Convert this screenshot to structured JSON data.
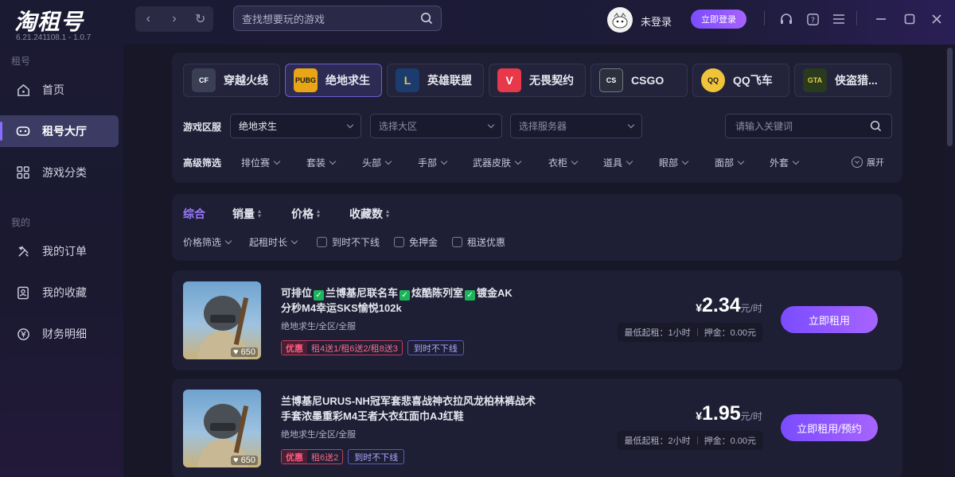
{
  "app": {
    "logo": "淘租号",
    "version": "6.21.241108.1 - 1.0.7"
  },
  "sidebar": {
    "section1": "租号",
    "section2": "我的",
    "items": [
      {
        "label": "首页",
        "icon": "home-icon"
      },
      {
        "label": "租号大厅",
        "icon": "gamepad-icon",
        "active": true
      },
      {
        "label": "游戏分类",
        "icon": "grid-icon"
      },
      {
        "label": "我的订单",
        "icon": "tools-icon"
      },
      {
        "label": "我的收藏",
        "icon": "bookmark-icon"
      },
      {
        "label": "财务明细",
        "icon": "money-icon"
      }
    ]
  },
  "topbar": {
    "search_placeholder": "查找想要玩的游戏",
    "user_name": "未登录",
    "login_label": "立即登录"
  },
  "games": [
    {
      "name": "穿越火线",
      "icon_text": "CF"
    },
    {
      "name": "绝地求生",
      "icon_text": "PUBG",
      "selected": true
    },
    {
      "name": "英雄联盟",
      "icon_text": "L"
    },
    {
      "name": "无畏契约",
      "icon_text": "V"
    },
    {
      "name": "CSGO",
      "icon_text": "CS"
    },
    {
      "name": "QQ飞车",
      "icon_text": "QQ"
    },
    {
      "name": "侠盗猎...",
      "icon_text": "GTA"
    }
  ],
  "filters": {
    "region_label": "游戏区服",
    "game_value": "绝地求生",
    "zone_placeholder": "选择大区",
    "server_placeholder": "选择服务器",
    "keyword_placeholder": "请输入关键词",
    "advanced_label": "高级筛选",
    "advanced": [
      "排位赛",
      "套装",
      "头部",
      "手部",
      "武器皮肤",
      "衣柜",
      "道具",
      "眼部",
      "面部",
      "外套"
    ],
    "expand_label": "展开"
  },
  "sort": {
    "tabs": [
      "综合",
      "销量",
      "价格",
      "收藏数"
    ],
    "price_filter": "价格筛选",
    "min_time": "起租时长",
    "checks": [
      "到时不下线",
      "免押金",
      "租送优惠"
    ]
  },
  "listings": [
    {
      "title_parts": [
        "可排位",
        "兰博基尼联名车",
        "炫酷陈列室",
        "镀金AK"
      ],
      "title_tail": "分秒M4幸运SKS愉悦102k",
      "server": "绝地求生/全区/全服",
      "promo_key": "优惠",
      "promo_val": "租4送1/租6送2/租8送3",
      "online_tag": "到时不下线",
      "likes": "650",
      "currency": "¥",
      "price": "2.34",
      "unit": "元/时",
      "min_rent": "最低起租：1小时",
      "deposit": "押金：0.00元",
      "button": "立即租用"
    },
    {
      "title": "兰博基尼URUS-NH冠军套悲喜战神衣拉风龙柏林裤战术手套浓墨重彩M4王者大衣红面巾AJ红鞋",
      "server": "绝地求生/全区/全服",
      "promo_key": "优惠",
      "promo_val": "租6送2",
      "online_tag": "到时不下线",
      "likes": "650",
      "currency": "¥",
      "price": "1.95",
      "unit": "元/时",
      "min_rent": "最低起租：2小时",
      "deposit": "押金：0.00元",
      "button": "立即租用/预约"
    }
  ],
  "colors": {
    "accent": "#8a6cff",
    "button": "#9b5cff",
    "promo": "#ff5a80"
  }
}
